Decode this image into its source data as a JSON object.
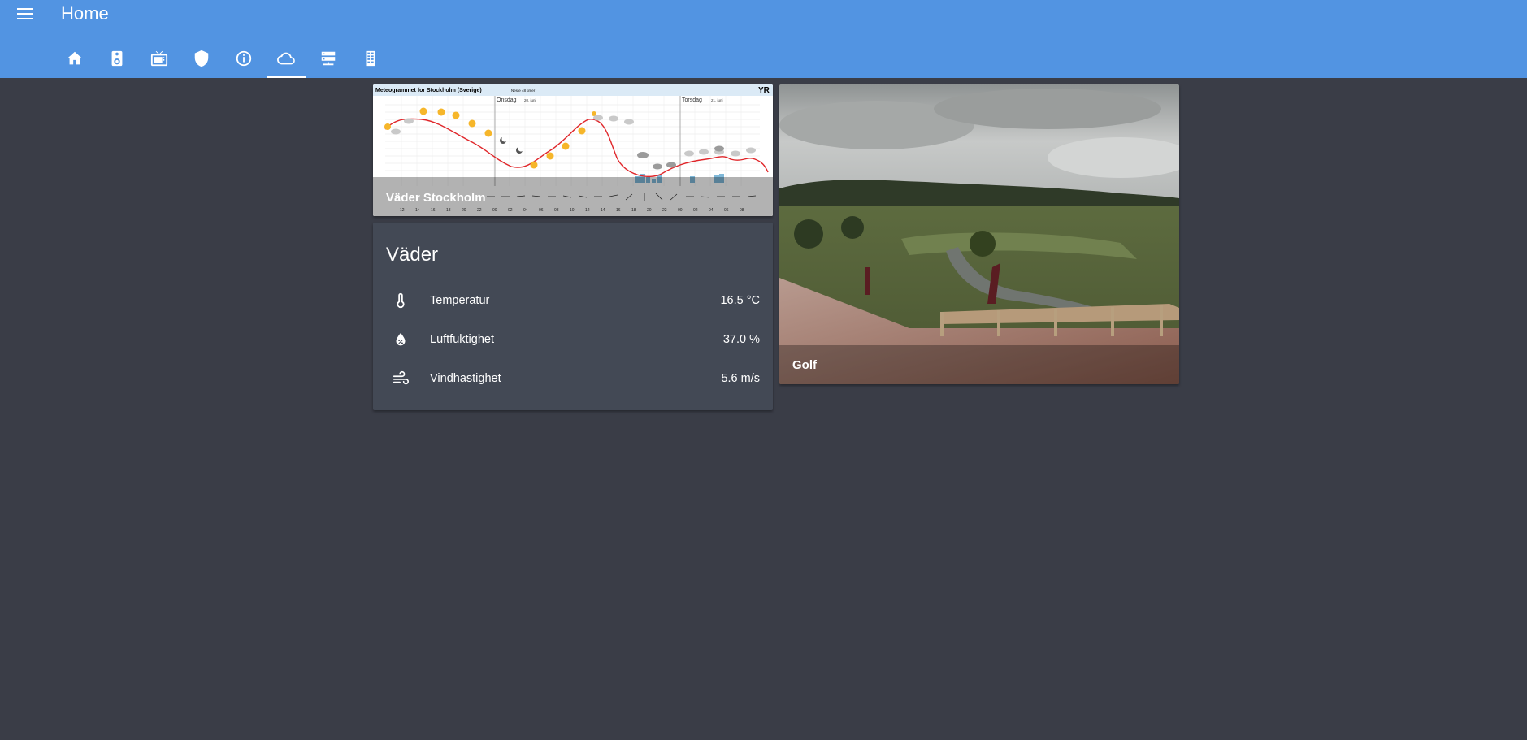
{
  "header": {
    "title": "Home",
    "menu_icon": "menu-icon"
  },
  "tabs": [
    {
      "icon": "home-icon",
      "active": false
    },
    {
      "icon": "speaker-icon",
      "active": false
    },
    {
      "icon": "tv-icon",
      "active": false
    },
    {
      "icon": "shield-icon",
      "active": false
    },
    {
      "icon": "info-icon",
      "active": false
    },
    {
      "icon": "cloud-icon",
      "active": true
    },
    {
      "icon": "server-icon",
      "active": false
    },
    {
      "icon": "door-icon",
      "active": false
    }
  ],
  "meteogram": {
    "caption": "Väder Stockholm",
    "chart_title": "Meteogrammet for Stockholm (Sverige)",
    "chart_subtitle": "Neste 48 timer",
    "logo": "YR",
    "day1": "Onsdag",
    "day1_date": "20. juni",
    "day2": "Torsdag",
    "day2_date": "21. juni",
    "hours": [
      "12",
      "14",
      "16",
      "18",
      "20",
      "22",
      "00",
      "02",
      "04",
      "06",
      "08",
      "10",
      "12",
      "14",
      "16",
      "18",
      "20",
      "22",
      "00",
      "02",
      "04",
      "06",
      "08"
    ]
  },
  "weather": {
    "title": "Väder",
    "rows": [
      {
        "label": "Temperatur",
        "value": "16.5 °C",
        "icon": "thermometer-icon"
      },
      {
        "label": "Luftfuktighet",
        "value": "37.0 %",
        "icon": "water-percent-icon"
      },
      {
        "label": "Vindhastighet",
        "value": "5.6 m/s",
        "icon": "wind-icon"
      }
    ]
  },
  "golf": {
    "caption": "Golf"
  },
  "colors": {
    "header": "#5294e2",
    "background": "#3a3d47",
    "card": "#434955",
    "temperature_line": "#e0262a"
  }
}
